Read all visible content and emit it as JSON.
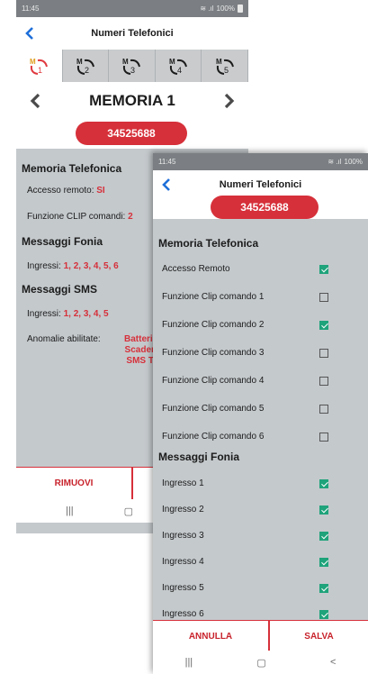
{
  "screen1": {
    "status": {
      "time": "11:45",
      "battery": "100%"
    },
    "title": "Numeri Telefonici",
    "tabs": [
      {
        "top": "M",
        "num": "1",
        "active": true
      },
      {
        "top": "M",
        "num": "2"
      },
      {
        "top": "M",
        "num": "3"
      },
      {
        "top": "M",
        "num": "4"
      },
      {
        "top": "M",
        "num": "5"
      }
    ],
    "memory_title": "MEMORIA 1",
    "number": "34525688",
    "memoria_telefonica": "Memoria Telefonica",
    "accesso_label": "Accesso remoto:",
    "accesso_value": "SI",
    "clip_label": "Funzione CLIP comandi:",
    "clip_value": "2",
    "messaggi_fonia": "Messaggi Fonia",
    "fonia_label": "Ingressi:",
    "fonia_value": "1, 2, 3, 4, 5, 6",
    "messaggi_sms": "Messaggi SMS",
    "sms_label": "Ingressi:",
    "sms_value": "1, 2, 3, 4, 5",
    "anomalie_label": "Anomalie abilitate:",
    "anomalie_values": [
      "Batteria S",
      "Scadenza",
      "SMS Test"
    ],
    "remove_label": "RIMUOVI",
    "nav": {
      "recent": "|||",
      "home": "▢"
    }
  },
  "screen2": {
    "status": {
      "time": "11:45",
      "battery": "100%"
    },
    "title": "Numeri Telefonici",
    "number": "34525688",
    "section_memoria": "Memoria Telefonica",
    "rows_memoria": [
      {
        "label": "Accesso Remoto",
        "checked": true
      },
      {
        "label": "Funzione Clip comando 1",
        "checked": false
      },
      {
        "label": "Funzione Clip comando 2",
        "checked": true
      },
      {
        "label": "Funzione Clip comando 3",
        "checked": false
      },
      {
        "label": "Funzione Clip comando 4",
        "checked": false
      },
      {
        "label": "Funzione Clip comando 5",
        "checked": false
      },
      {
        "label": "Funzione Clip comando 6",
        "checked": false
      }
    ],
    "section_fonia": "Messaggi Fonia",
    "rows_fonia": [
      {
        "label": "Ingresso 1",
        "checked": true
      },
      {
        "label": "Ingresso 2",
        "checked": true
      },
      {
        "label": "Ingresso 3",
        "checked": true
      },
      {
        "label": "Ingresso 4",
        "checked": true
      },
      {
        "label": "Ingresso 5",
        "checked": true
      },
      {
        "label": "Ingresso 6",
        "checked": true
      }
    ],
    "cancel_label": "ANNULLA",
    "save_label": "SALVA",
    "nav": {
      "recent": "|||",
      "home": "▢",
      "back": "<"
    }
  },
  "colors": {
    "accent": "#d6303a",
    "check": "#1fa37a",
    "link_blue": "#1e6fd9"
  }
}
